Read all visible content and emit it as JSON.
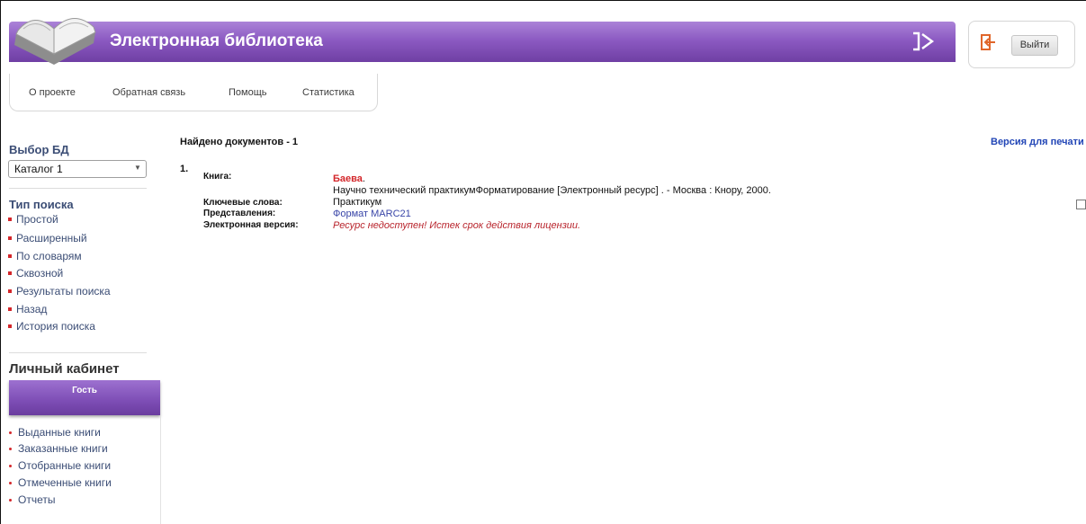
{
  "header": {
    "title": "Электронная библиотека",
    "logout_label": "Выйти"
  },
  "menu": [
    {
      "label": "О проекте"
    },
    {
      "label": "Обратная связь"
    },
    {
      "label": "Помощь"
    },
    {
      "label": "Статистика"
    }
  ],
  "sidebar": {
    "db_title": "Выбор БД",
    "db_selected": "Каталог 1",
    "search_title": "Тип поиска",
    "search_items": [
      {
        "label": "Простой"
      },
      {
        "label": "Расширенный"
      },
      {
        "label": "По словарям"
      },
      {
        "label": "Сквозной"
      },
      {
        "label": "Результаты поиска"
      },
      {
        "label": "Назад"
      },
      {
        "label": "История поиска"
      }
    ],
    "cabinet_title": "Личный кабинет",
    "guest_label": "Гость",
    "cabinet_items": [
      {
        "label": "Выданные книги"
      },
      {
        "label": "Заказанные книги"
      },
      {
        "label": "Отобранные книги"
      },
      {
        "label": "Отмеченные книги"
      },
      {
        "label": "Отчеты"
      }
    ]
  },
  "main": {
    "found_text": "Найдено документов - 1",
    "print_link": "Версия для печати",
    "record": {
      "number": "1.",
      "book_label": "Книга:",
      "author": "Баева",
      "author_dot": ".",
      "description": "Научно технический практикумФорматирование [Электронный ресурс] . - Москва : Кнору, 2000.",
      "keywords_label": "Ключевые слова:",
      "keywords": "Практикум",
      "views_label": "Представления:",
      "views_link": "Формат MARC21",
      "ebook_label": "Электронная версия:",
      "ebook_status": "Ресурс недоступен! Истек срок действия лицензии."
    }
  },
  "colors": {
    "accent_purple": "#8c5ac2",
    "link_blue": "#2145b6",
    "alert_red": "#d3262a"
  }
}
